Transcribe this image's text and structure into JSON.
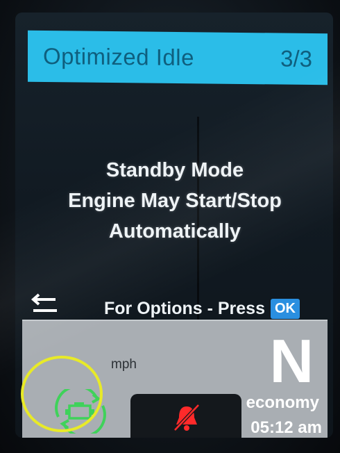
{
  "header": {
    "title": "Optimized Idle",
    "page_indicator": "3/3"
  },
  "message": {
    "line1": "Standby Mode",
    "line2": "Engine May Start/Stop",
    "line3": "Automatically"
  },
  "footer": {
    "options_label": "For Options - Press",
    "ok_label": "OK",
    "back_icon": "back-arrow-icon"
  },
  "status": {
    "speed_unit": "mph",
    "gear": "N",
    "drive_mode": "economy",
    "time": "05:12 am",
    "engine_icon": "auto-start-stop-icon",
    "warning_icon": "seatbelt-bell-warning-icon"
  },
  "colors": {
    "title_bar": "#2bbde8",
    "ok_button": "#2a8fe0",
    "engine_icon": "#3fd25a",
    "warning_icon": "#ff2a2a",
    "highlight_ring": "#e8ea28"
  }
}
